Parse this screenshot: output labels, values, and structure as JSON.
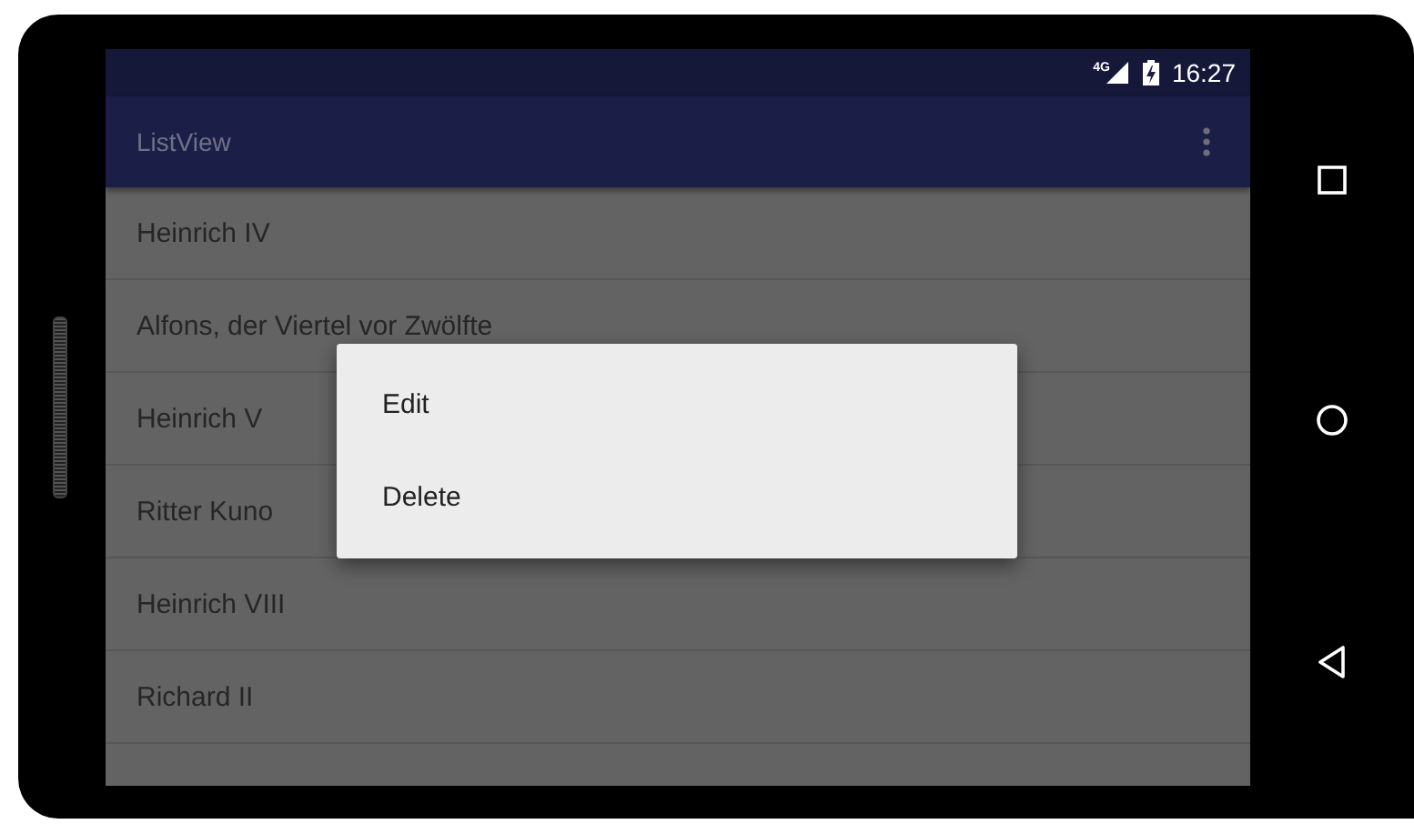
{
  "status_bar": {
    "network": "4G",
    "time": "16:27"
  },
  "toolbar": {
    "title": "ListView"
  },
  "list": {
    "items": [
      {
        "label": "Heinrich IV"
      },
      {
        "label": "Alfons, der Viertel vor Zwölfte"
      },
      {
        "label": "Heinrich V"
      },
      {
        "label": "Ritter Kuno"
      },
      {
        "label": "Heinrich VIII"
      },
      {
        "label": "Richard II"
      }
    ]
  },
  "context_menu": {
    "items": [
      {
        "label": "Edit"
      },
      {
        "label": "Delete"
      }
    ]
  }
}
